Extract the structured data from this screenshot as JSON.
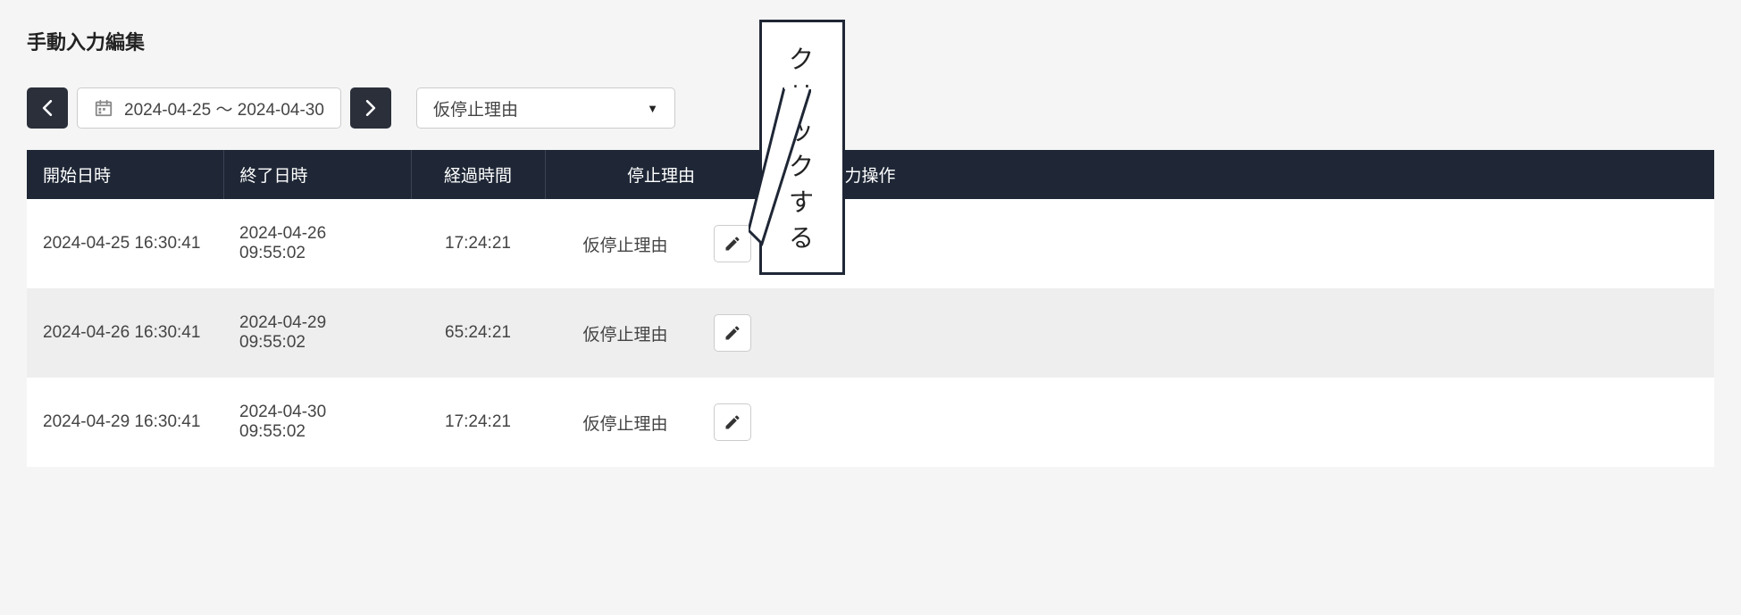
{
  "page": {
    "title": "手動入力編集"
  },
  "toolbar": {
    "date_range": "2024-04-25 ～ 2024-04-30",
    "reason_label": "仮停止理由"
  },
  "table": {
    "headers": {
      "start": "開始日時",
      "end": "終了日時",
      "elapsed": "経過時間",
      "reason": "停止理由",
      "manual": "手動入力操作"
    },
    "rows": [
      {
        "start": "2024-04-25 16:30:41",
        "end": "2024-04-26 09:55:02",
        "elapsed": "17:24:21",
        "reason": "仮停止理由"
      },
      {
        "start": "2024-04-26 16:30:41",
        "end": "2024-04-29 09:55:02",
        "elapsed": "65:24:21",
        "reason": "仮停止理由"
      },
      {
        "start": "2024-04-29 16:30:41",
        "end": "2024-04-30 09:55:02",
        "elapsed": "17:24:21",
        "reason": "仮停止理由"
      }
    ]
  },
  "callout": {
    "text": "クリックする"
  }
}
